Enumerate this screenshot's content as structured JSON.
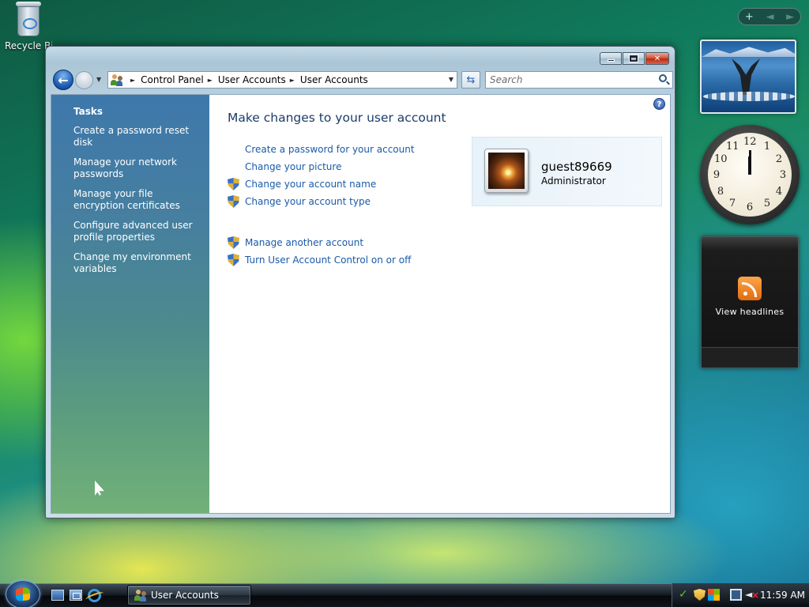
{
  "desktop": {
    "recycle_bin_label": "Recycle Bin"
  },
  "window": {
    "address": {
      "crumbs": [
        "Control Panel",
        "User Accounts",
        "User Accounts"
      ]
    },
    "search": {
      "placeholder": "Search"
    },
    "tasks": {
      "heading": "Tasks",
      "links": [
        "Create a password reset disk",
        "Manage your network passwords",
        "Manage your file encryption certificates",
        "Configure advanced user profile properties",
        "Change my environment variables"
      ]
    },
    "main": {
      "title": "Make changes to your user account",
      "actions": [
        "Create a password for your account",
        "Change your picture",
        "Change your account name",
        "Change your account type"
      ],
      "other_actions": [
        "Manage another account",
        "Turn User Account Control on or off"
      ]
    },
    "user": {
      "name": "guest89669",
      "role": "Administrator"
    }
  },
  "gadgets": {
    "controls": [
      "+",
      "◄",
      "►"
    ],
    "clock_numerals": [
      "12",
      "1",
      "2",
      "3",
      "4",
      "5",
      "6",
      "7",
      "8",
      "9",
      "10",
      "11"
    ],
    "clock_time": "12:00",
    "rss_label": "View headlines"
  },
  "taskbar": {
    "active_window": "User Accounts",
    "time": "11:59 AM"
  },
  "icons": {
    "back": "back-arrow-icon",
    "forward": "forward-arrow-icon",
    "refresh": "refresh-icon",
    "search": "magnifier-icon",
    "help": "help-icon",
    "uac_shield": "uac-shield-icon"
  },
  "colors": {
    "link": "#1a5aa8",
    "title": "#1b3c6a",
    "task_pane_top": "#3e78ab",
    "task_pane_bottom": "#72b178"
  }
}
